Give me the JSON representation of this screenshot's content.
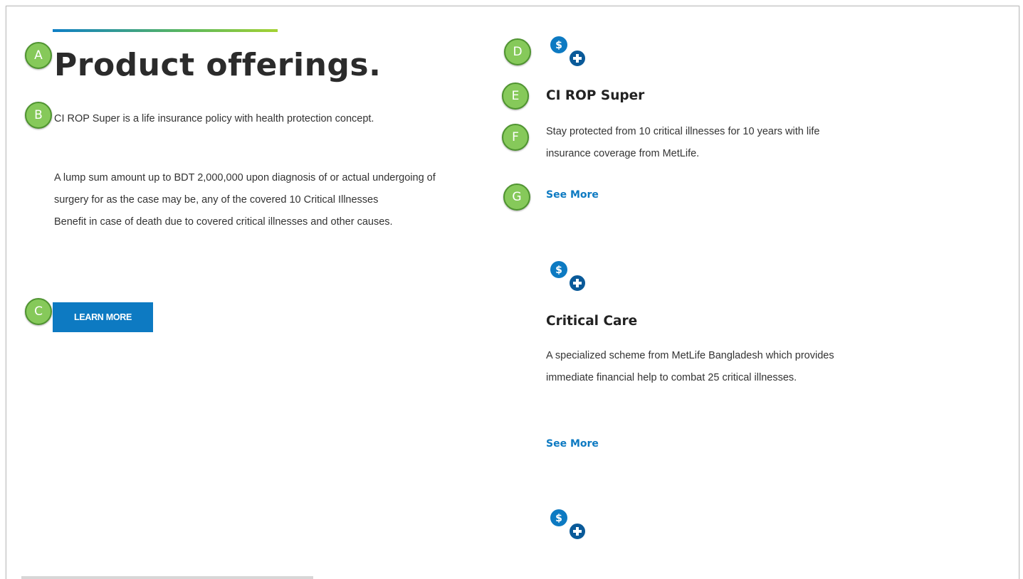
{
  "section": {
    "heading": "Product offerings.",
    "intro": "CI ROP Super is a life insurance policy with health protection concept.",
    "details": [
      "A lump sum amount up to BDT 2,000,000 upon diagnosis of or actual undergoing of surgery for as the case may be, any of the covered 10 Critical Illnesses",
      "Benefit in case of death due to covered critical illnesses and other causes."
    ],
    "learn_more_label": "LEARN MORE"
  },
  "markers": {
    "a": "A",
    "b": "B",
    "c": "C",
    "d": "D",
    "e": "E",
    "f": "F",
    "g": "G"
  },
  "cards": [
    {
      "title": "CI ROP Super",
      "description": "Stay protected from 10 critical illnesses for 10 years with life insurance coverage from MetLife.",
      "link": "See More",
      "icon": "money-plus-icon"
    },
    {
      "title": "Critical Care",
      "description": "A specialized scheme from MetLife Bangladesh which provides immediate financial help to combat 25 critical illnesses.",
      "link": "See More",
      "icon": "money-plus-icon"
    },
    {
      "icon": "money-plus-icon"
    }
  ],
  "colors": {
    "brand_blue": "#0d7ac2",
    "icon_dark_blue": "#0a5a99",
    "marker_green": "#86c95a"
  }
}
